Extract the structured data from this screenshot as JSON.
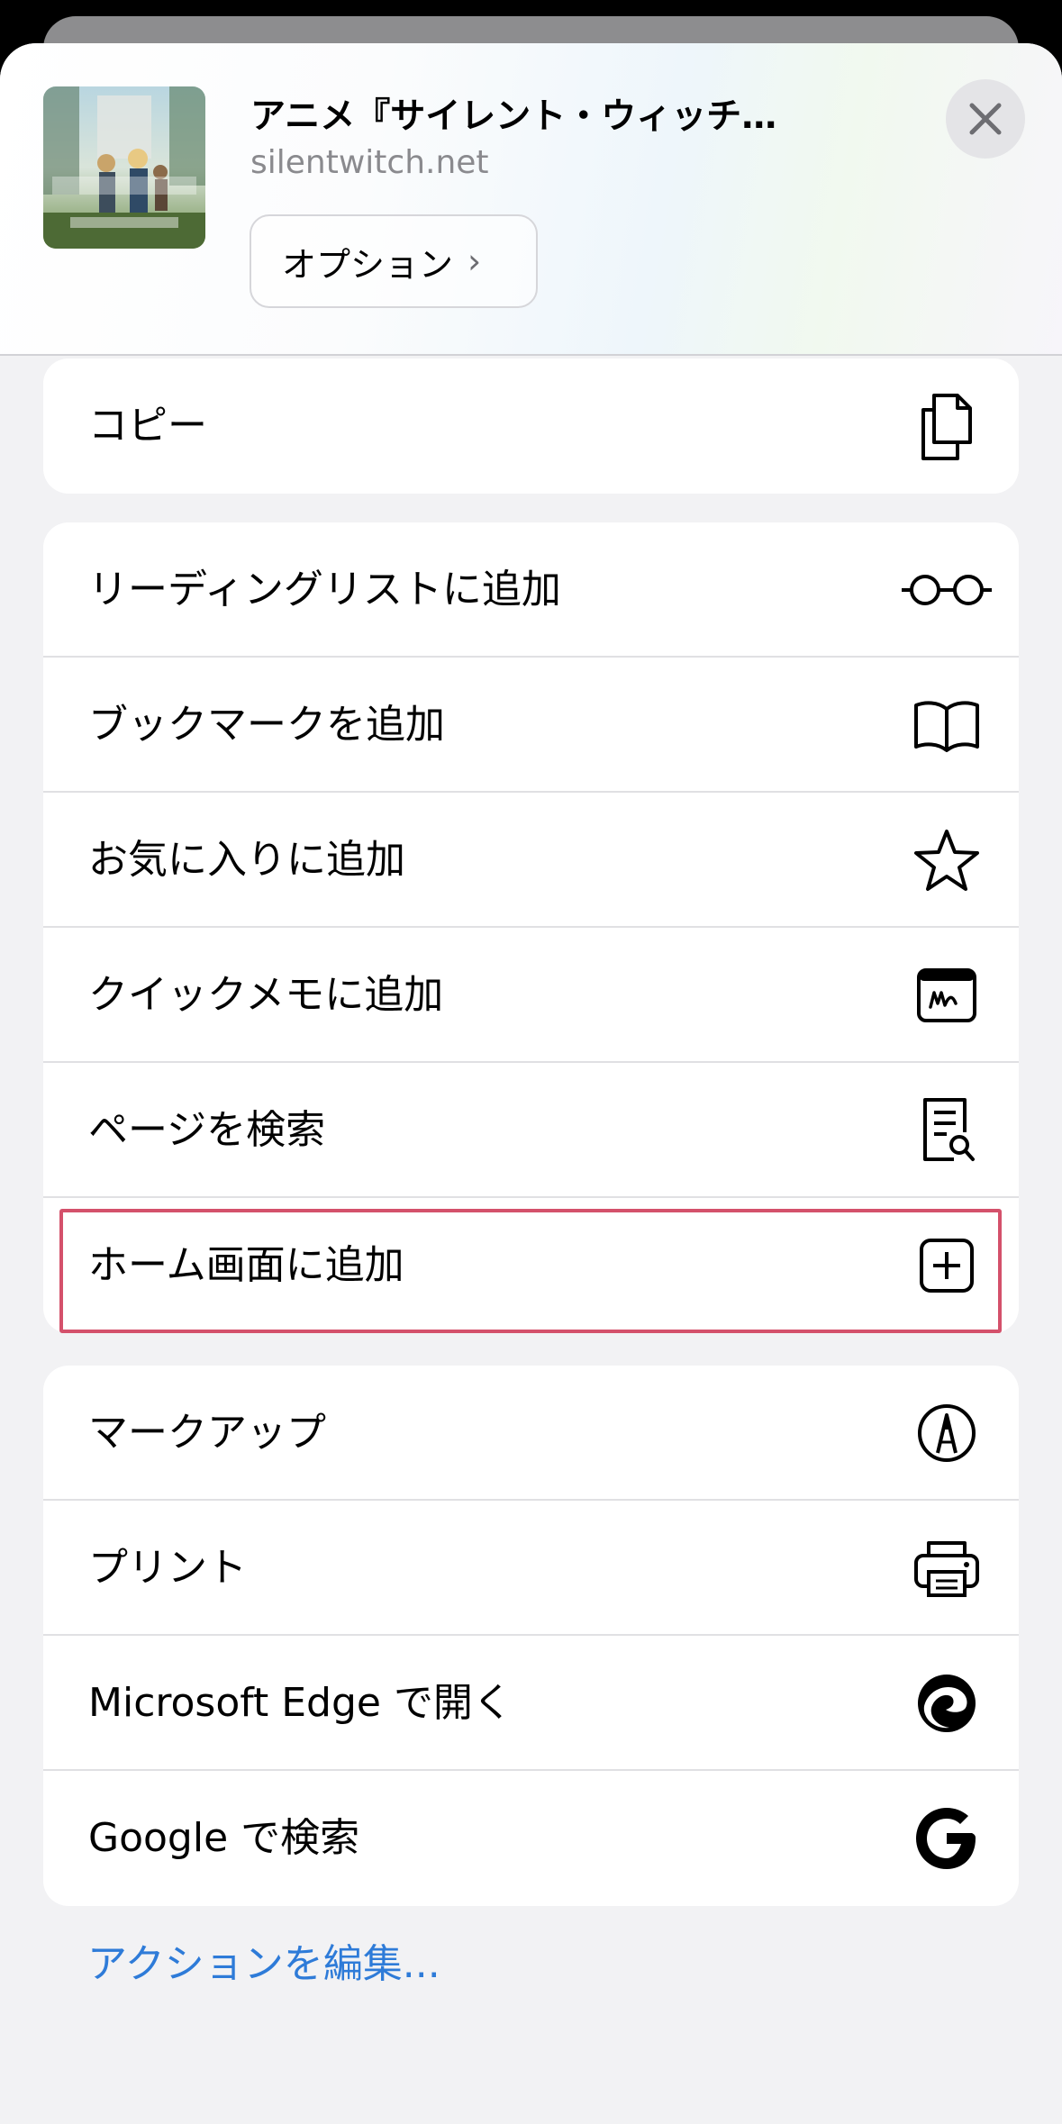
{
  "header": {
    "title": "アニメ『サイレント・ウィッチ…",
    "domain": "silentwitch.net",
    "options_label": "オプション",
    "options_chevron": "›",
    "close_label": "×"
  },
  "groups": [
    {
      "items": [
        {
          "label": "コピー",
          "icon": "copy-icon"
        }
      ]
    },
    {
      "items": [
        {
          "label": "リーディングリストに追加",
          "icon": "glasses-icon"
        },
        {
          "label": "ブックマークを追加",
          "icon": "book-icon"
        },
        {
          "label": "お気に入りに追加",
          "icon": "star-icon"
        },
        {
          "label": "クイックメモに追加",
          "icon": "quick-note-icon"
        },
        {
          "label": "ページを検索",
          "icon": "find-on-page-icon"
        },
        {
          "label": "ホーム画面に追加",
          "icon": "add-square-icon"
        }
      ]
    },
    {
      "items": [
        {
          "label": "マークアップ",
          "icon": "markup-pen-icon"
        },
        {
          "label": "プリント",
          "icon": "printer-icon"
        },
        {
          "label": "Microsoft Edge で開く",
          "icon": "edge-icon"
        },
        {
          "label": "Google で検索",
          "icon": "google-icon"
        }
      ]
    }
  ],
  "footer": {
    "edit_actions": "アクションを編集..."
  },
  "colors": {
    "accent_blue": "#2e7bd8",
    "highlight_border": "#d4516b",
    "background": "#f2f2f4"
  }
}
